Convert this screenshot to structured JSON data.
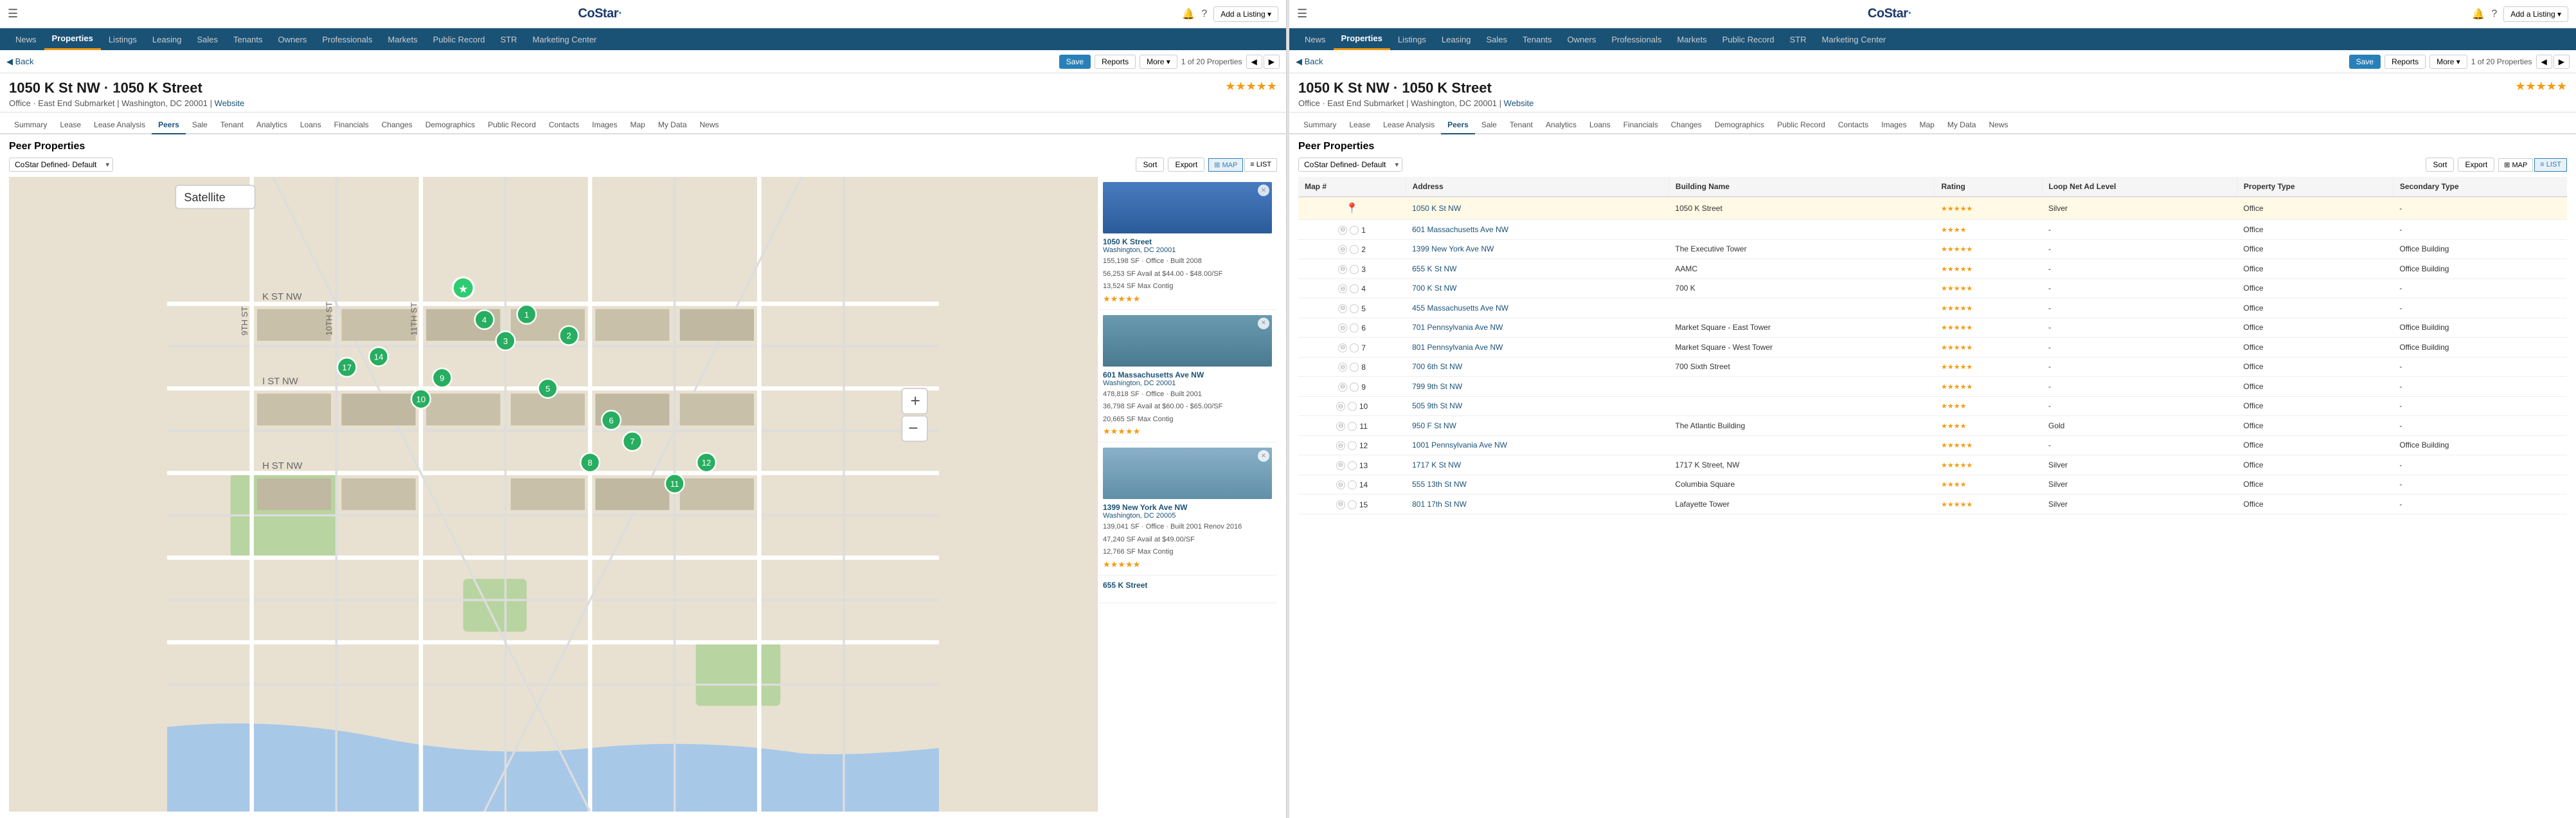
{
  "logo": "CoStar",
  "panels": [
    {
      "id": "left",
      "topbar": {
        "hamburger": "☰",
        "logo": "CoStar",
        "bell": "🔔",
        "help": "?",
        "addListing": "Add a Listing ▾"
      },
      "mainNav": {
        "items": [
          {
            "label": "News",
            "active": false
          },
          {
            "label": "Properties",
            "active": true
          },
          {
            "label": "Listings",
            "active": false
          },
          {
            "label": "Leasing",
            "active": false
          },
          {
            "label": "Sales",
            "active": false
          },
          {
            "label": "Tenants",
            "active": false
          },
          {
            "label": "Owners",
            "active": false
          },
          {
            "label": "Professionals",
            "active": false
          },
          {
            "label": "Markets",
            "active": false
          },
          {
            "label": "Public Record",
            "active": false
          },
          {
            "label": "STR",
            "active": false
          },
          {
            "label": "Marketing Center",
            "active": false
          }
        ]
      },
      "toolbar": {
        "back": "◀ Back",
        "save": "Save",
        "reports": "Reports",
        "more": "More ▾",
        "count": "1 of 20 Properties",
        "prev": "◀",
        "next": "▶"
      },
      "property": {
        "title": "1050 K St NW · 1050 K Street",
        "subtitle": "Office · East End Submarket | Washington, DC 20001 |",
        "website": "Website",
        "stars": "★★★★★",
        "starsCount": 5
      },
      "subNav": {
        "items": [
          {
            "label": "Summary",
            "active": false
          },
          {
            "label": "Lease",
            "active": false
          },
          {
            "label": "Lease Analysis",
            "active": false
          },
          {
            "label": "Peers",
            "active": true
          },
          {
            "label": "Sale",
            "active": false
          },
          {
            "label": "Tenant",
            "active": false
          },
          {
            "label": "Analytics",
            "active": false
          },
          {
            "label": "Loans",
            "active": false
          },
          {
            "label": "Financials",
            "active": false
          },
          {
            "label": "Changes",
            "active": false
          },
          {
            "label": "Demographics",
            "active": false
          },
          {
            "label": "Public Record",
            "active": false
          },
          {
            "label": "Contacts",
            "active": false
          },
          {
            "label": "Images",
            "active": false
          },
          {
            "label": "Map",
            "active": false
          },
          {
            "label": "My Data",
            "active": false
          },
          {
            "label": "News",
            "active": false
          }
        ]
      },
      "peers": {
        "title": "Peer Properties",
        "dropdown": "CoStar Defined- Default",
        "sortBtn": "Sort",
        "exportBtn": "Export",
        "viewMap": "MAP",
        "viewList": "LIST",
        "activeView": "map",
        "cards": [
          {
            "address": "1050 K Street",
            "city": "Washington, DC 20001",
            "detail1": "155,198 SF · Office · Built 2008",
            "detail2": "56,253 SF Avail at $44.00 - $48.00/SF",
            "detail3": "13,524 SF Max Contig",
            "stars": "★★★★★"
          },
          {
            "address": "601 Massachusetts Ave NW",
            "city": "Washington, DC 20001",
            "detail1": "478,818 SF · Office · Built 2001",
            "detail2": "36,798 SF Avail at $60.00 - $65.00/SF",
            "detail3": "20,665 SF Max Contig",
            "stars": "★★★★★"
          },
          {
            "address": "1399 New York Ave NW",
            "city": "Washington, DC 20005",
            "detail1": "139,041 SF · Office · Built 2001 Renov 2016",
            "detail2": "47,240 SF Avail at $49.00/SF",
            "detail3": "12,766 SF Max Contig",
            "stars": "★★★★★"
          },
          {
            "address": "655 K Street",
            "city": "",
            "detail1": "",
            "detail2": "",
            "detail3": "",
            "stars": ""
          }
        ]
      }
    },
    {
      "id": "right",
      "topbar": {
        "hamburger": "☰",
        "logo": "CoStar",
        "bell": "🔔",
        "help": "?",
        "addListing": "Add a Listing ▾"
      },
      "mainNav": {
        "items": [
          {
            "label": "News",
            "active": false
          },
          {
            "label": "Properties",
            "active": true
          },
          {
            "label": "Listings",
            "active": false
          },
          {
            "label": "Leasing",
            "active": false
          },
          {
            "label": "Sales",
            "active": false
          },
          {
            "label": "Tenants",
            "active": false
          },
          {
            "label": "Owners",
            "active": false
          },
          {
            "label": "Professionals",
            "active": false
          },
          {
            "label": "Markets",
            "active": false
          },
          {
            "label": "Public Record",
            "active": false
          },
          {
            "label": "STR",
            "active": false
          },
          {
            "label": "Marketing Center",
            "active": false
          }
        ]
      },
      "toolbar": {
        "back": "◀ Back",
        "save": "Save",
        "reports": "Reports",
        "more": "More ▾",
        "count": "1 of 20 Properties",
        "prev": "◀",
        "next": "▶"
      },
      "property": {
        "title": "1050 K St NW · 1050 K Street",
        "subtitle": "Office · East End Submarket | Washington, DC 20001 |",
        "website": "Website",
        "stars": "★★★★★",
        "starsCount": 5
      },
      "subNav": {
        "items": [
          {
            "label": "Summary",
            "active": false
          },
          {
            "label": "Lease",
            "active": false
          },
          {
            "label": "Lease Analysis",
            "active": false
          },
          {
            "label": "Peers",
            "active": true
          },
          {
            "label": "Sale",
            "active": false
          },
          {
            "label": "Tenant",
            "active": false
          },
          {
            "label": "Analytics",
            "active": false
          },
          {
            "label": "Loans",
            "active": false
          },
          {
            "label": "Financials",
            "active": false
          },
          {
            "label": "Changes",
            "active": false
          },
          {
            "label": "Demographics",
            "active": false
          },
          {
            "label": "Public Record",
            "active": false
          },
          {
            "label": "Contacts",
            "active": false
          },
          {
            "label": "Images",
            "active": false
          },
          {
            "label": "Map",
            "active": false
          },
          {
            "label": "My Data",
            "active": false
          },
          {
            "label": "News",
            "active": false
          }
        ]
      },
      "peers": {
        "title": "Peer Properties",
        "dropdown": "CoStar Defined- Default",
        "sortBtn": "Sort",
        "exportBtn": "Export",
        "viewMap": "MAP",
        "viewList": "LIST",
        "activeView": "list",
        "tableHeaders": [
          "Map #",
          "Address",
          "Building Name",
          "Rating",
          "Loop Net Ad Level",
          "Property Type",
          "Secondary Type"
        ],
        "tableRows": [
          {
            "mapNum": "",
            "address": "1050 K St NW",
            "building": "1050 K Street",
            "rating": "★★★★★",
            "loopNet": "Silver",
            "propType": "Office",
            "secType": "-",
            "highlighted": true,
            "icon": "pin"
          },
          {
            "mapNum": "1",
            "address": "601 Massachusetts Ave NW",
            "building": "",
            "rating": "★★★★",
            "loopNet": "-",
            "propType": "Office",
            "secType": "-",
            "highlighted": false
          },
          {
            "mapNum": "2",
            "address": "1399 New York Ave NW",
            "building": "The Executive Tower",
            "rating": "★★★★★",
            "loopNet": "-",
            "propType": "Office",
            "secType": "Office Building",
            "highlighted": false
          },
          {
            "mapNum": "3",
            "address": "655 K St NW",
            "building": "AAMC",
            "rating": "★★★★★",
            "loopNet": "-",
            "propType": "Office",
            "secType": "Office Building",
            "highlighted": false
          },
          {
            "mapNum": "4",
            "address": "700 K St NW",
            "building": "700 K",
            "rating": "★★★★★",
            "loopNet": "-",
            "propType": "Office",
            "secType": "-",
            "highlighted": false
          },
          {
            "mapNum": "5",
            "address": "455 Massachusetts Ave NW",
            "building": "",
            "rating": "★★★★★",
            "loopNet": "-",
            "propType": "Office",
            "secType": "-",
            "highlighted": false
          },
          {
            "mapNum": "6",
            "address": "701 Pennsylvania Ave NW",
            "building": "Market Square - East Tower",
            "rating": "★★★★★",
            "loopNet": "-",
            "propType": "Office",
            "secType": "Office Building",
            "highlighted": false
          },
          {
            "mapNum": "7",
            "address": "801 Pennsylvania Ave NW",
            "building": "Market Square - West Tower",
            "rating": "★★★★★",
            "loopNet": "-",
            "propType": "Office",
            "secType": "Office Building",
            "highlighted": false
          },
          {
            "mapNum": "8",
            "address": "700 6th St NW",
            "building": "700 Sixth Street",
            "rating": "★★★★★",
            "loopNet": "-",
            "propType": "Office",
            "secType": "-",
            "highlighted": false
          },
          {
            "mapNum": "9",
            "address": "799 9th St NW",
            "building": "",
            "rating": "★★★★★",
            "loopNet": "-",
            "propType": "Office",
            "secType": "-",
            "highlighted": false
          },
          {
            "mapNum": "10",
            "address": "505 9th St NW",
            "building": "",
            "rating": "★★★★",
            "loopNet": "-",
            "propType": "Office",
            "secType": "-",
            "highlighted": false
          },
          {
            "mapNum": "11",
            "address": "950 F St NW",
            "building": "The Atlantic Building",
            "rating": "★★★★",
            "loopNet": "Gold",
            "propType": "Office",
            "secType": "-",
            "highlighted": false
          },
          {
            "mapNum": "12",
            "address": "1001 Pennsylvania Ave NW",
            "building": "",
            "rating": "★★★★★",
            "loopNet": "-",
            "propType": "Office",
            "secType": "Office Building",
            "highlighted": false
          },
          {
            "mapNum": "13",
            "address": "1717 K St NW",
            "building": "1717 K Street, NW",
            "rating": "★★★★★",
            "loopNet": "Silver",
            "propType": "Office",
            "secType": "-",
            "highlighted": false
          },
          {
            "mapNum": "14",
            "address": "555 13th St NW",
            "building": "Columbia Square",
            "rating": "★★★★",
            "loopNet": "Silver",
            "propType": "Office",
            "secType": "-",
            "highlighted": false
          },
          {
            "mapNum": "15",
            "address": "801 17th St NW",
            "building": "Lafayette Tower",
            "rating": "★★★★★",
            "loopNet": "Silver",
            "propType": "Office",
            "secType": "-",
            "highlighted": false
          }
        ]
      }
    }
  ]
}
